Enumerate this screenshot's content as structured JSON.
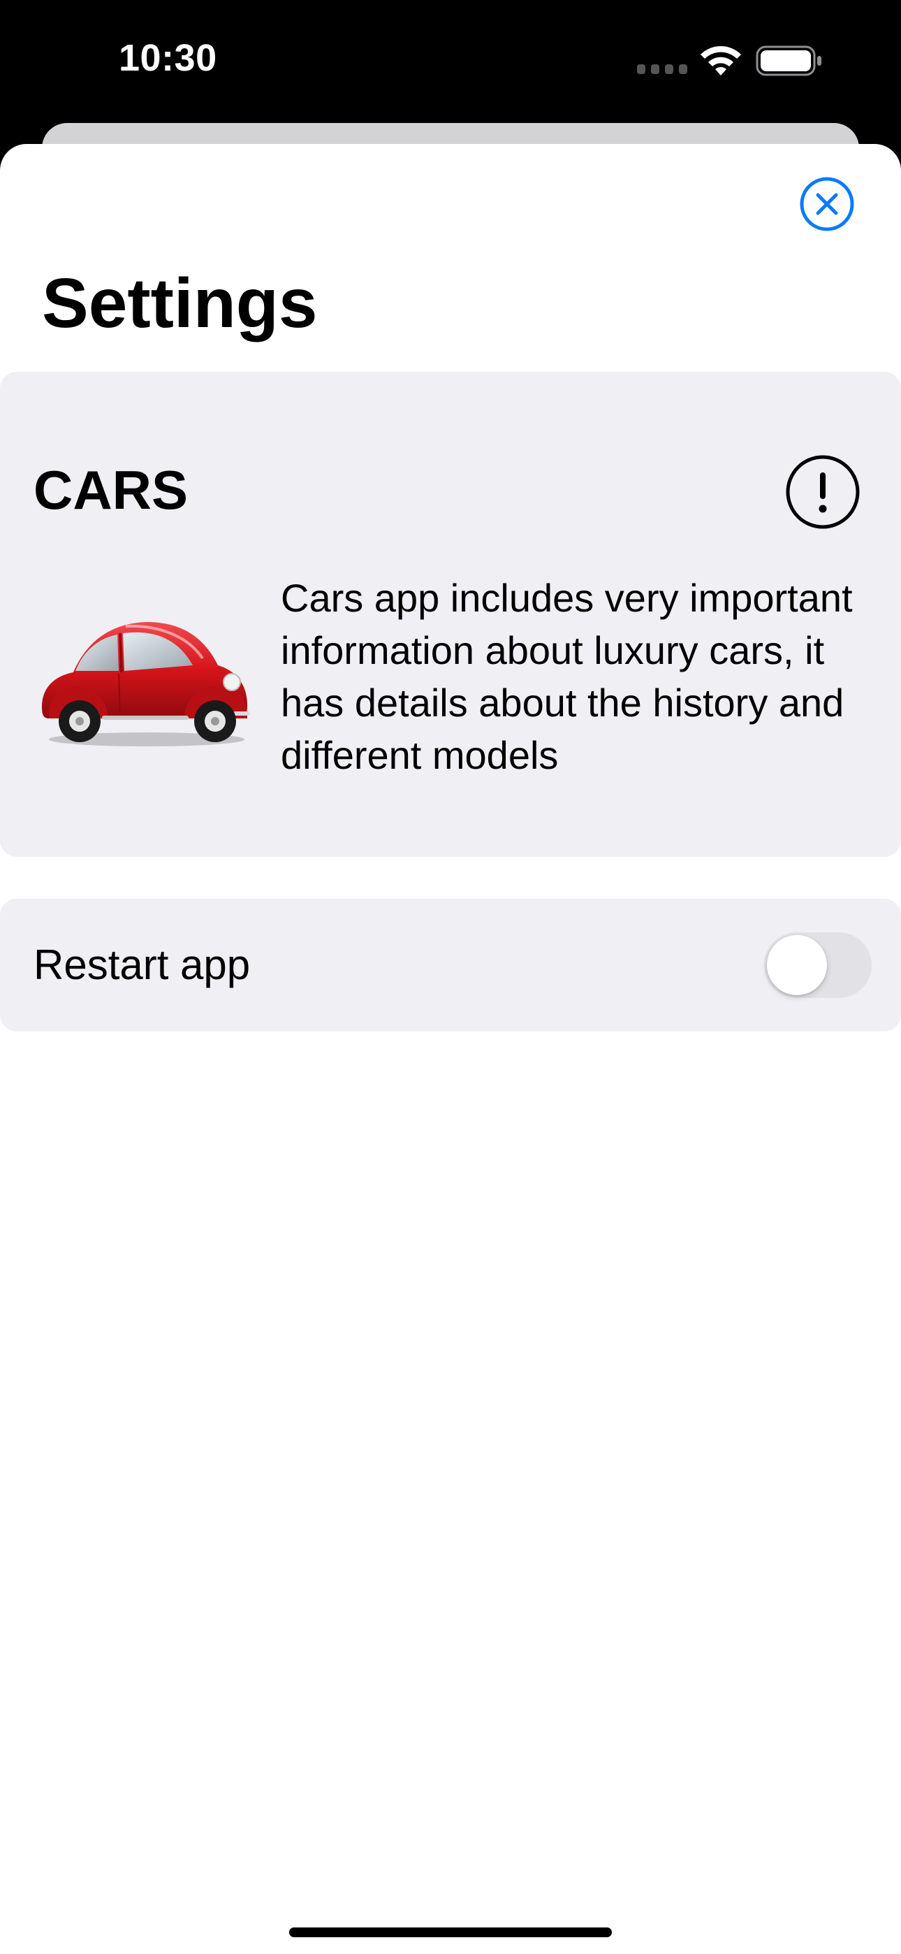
{
  "status_bar": {
    "time": "10:30",
    "icons": [
      "cellular-signal-icon",
      "wifi-icon",
      "battery-icon"
    ]
  },
  "sheet": {
    "close_icon": "close-circle-icon",
    "title": "Settings"
  },
  "cars_section": {
    "heading": "CARS",
    "info_icon": "exclamation-circle-icon",
    "image": "red-car-illustration",
    "description": "Cars app includes very important information about luxury cars, it has details about the history and different models"
  },
  "restart_row": {
    "label": "Restart app",
    "toggle_on": false
  },
  "colors": {
    "accent": "#0a7aff",
    "card_background": "#efeff4",
    "toggle_off": "#e2e2e6",
    "car_red": "#d4141a"
  }
}
